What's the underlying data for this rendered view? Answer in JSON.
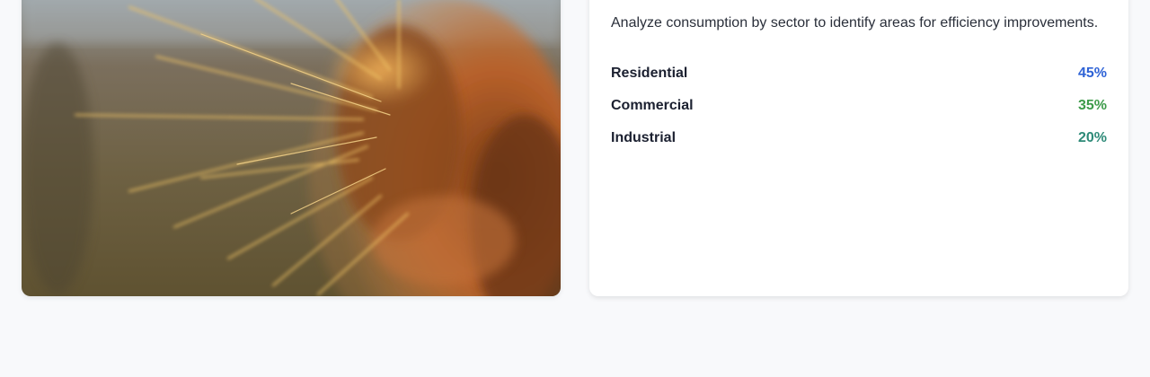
{
  "photo": {
    "subject": "cactus-spines-closeup"
  },
  "sector_panel": {
    "description": "Analyze consumption by sector to identify areas for efficiency improvements.",
    "sectors": [
      {
        "label": "Residential",
        "value": "45%",
        "color": "#2f63d6"
      },
      {
        "label": "Commercial",
        "value": "35%",
        "color": "#3d9b4a"
      },
      {
        "label": "Industrial",
        "value": "20%",
        "color": "#2e8a78"
      }
    ]
  }
}
